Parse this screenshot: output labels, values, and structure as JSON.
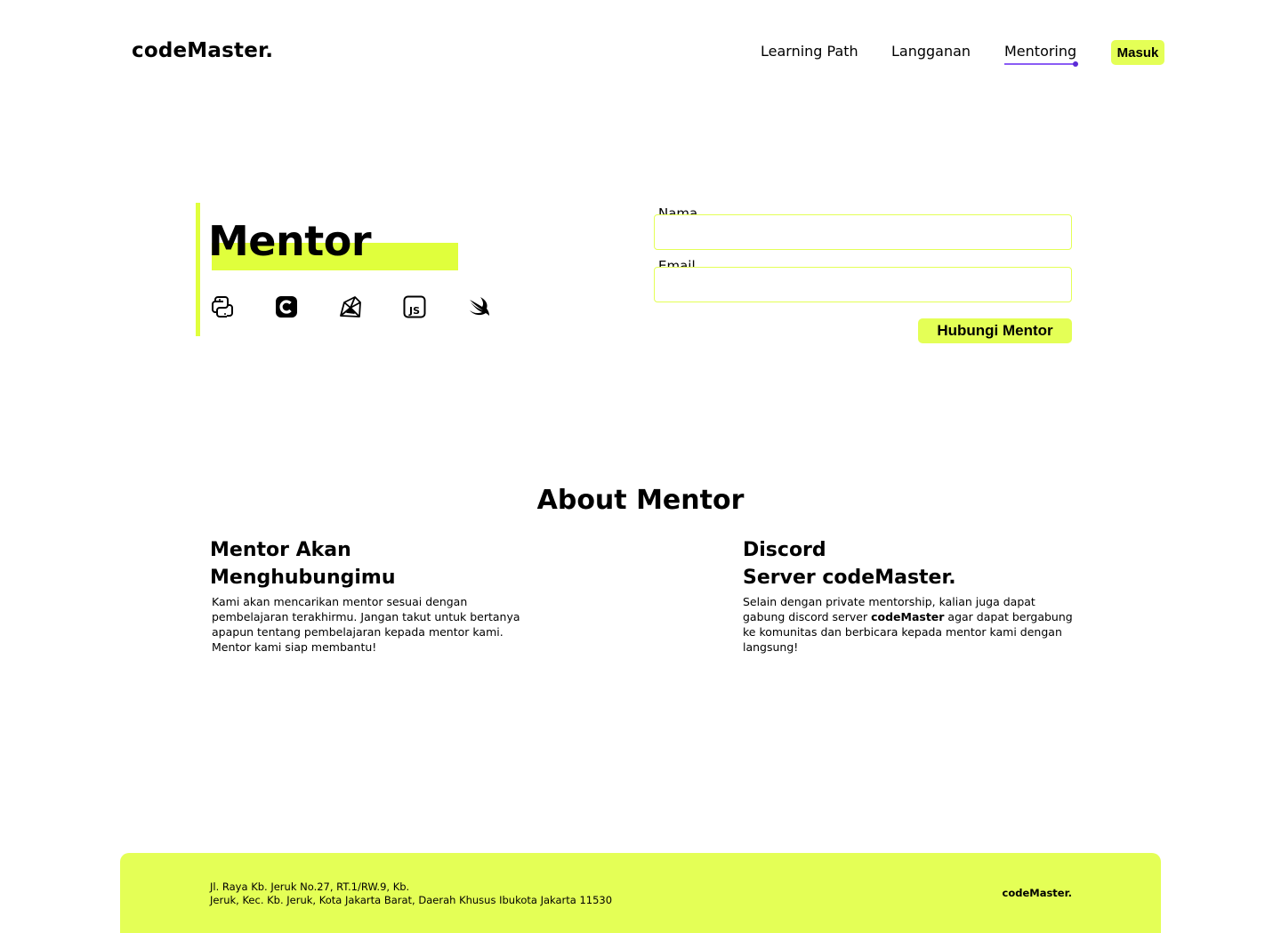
{
  "header": {
    "logo": "codeMaster.",
    "nav": [
      {
        "label": "Learning Path",
        "active": false
      },
      {
        "label": "Langganan",
        "active": false
      },
      {
        "label": "Mentoring",
        "active": true
      }
    ],
    "login_label": "Masuk"
  },
  "hero": {
    "title": "Mentor",
    "tech_icons": [
      "python-icon",
      "c-language-icon",
      "ruby-icon",
      "javascript-icon",
      "swift-icon"
    ]
  },
  "form": {
    "name_label": "Nama",
    "name_value": "",
    "email_label": "Email",
    "email_value": "",
    "submit_label": "Hubungi Mentor"
  },
  "about": {
    "title": "About Mentor",
    "left": {
      "title_line1": "Mentor Akan",
      "title_line2": "Menghubungimu",
      "body_lines": [
        "Kami akan mencarikan mentor sesuai dengan",
        "pembelajaran terakhirmu. Jangan takut untuk bertanya",
        "apapun tentang pembelajaran kepada mentor kami.",
        "Mentor kami siap membantu!"
      ]
    },
    "right": {
      "title_line1": "Discord",
      "title_line2": "Server codeMaster.",
      "body_line1": "Selain dengan private mentorship, kalian juga dapat",
      "body_line2_pre": "gabung discord server ",
      "body_line2_bold": "codeMaster",
      "body_line2_post": " agar dapat bergabung",
      "body_line3": "ke komunitas dan berbicara kepada mentor kami dengan",
      "body_line4": "langsung!"
    }
  },
  "footer": {
    "address_line1": "Jl. Raya Kb. Jeruk No.27, RT.1/RW.9, Kb.",
    "address_line2": "Jeruk, Kec. Kb. Jeruk, Kota Jakarta Barat, Daerah Khusus Ibukota Jakarta 11530",
    "logo": "codeMaster."
  },
  "colors": {
    "accent": "#e4ff56",
    "active_underline": "#8a5cf5"
  }
}
